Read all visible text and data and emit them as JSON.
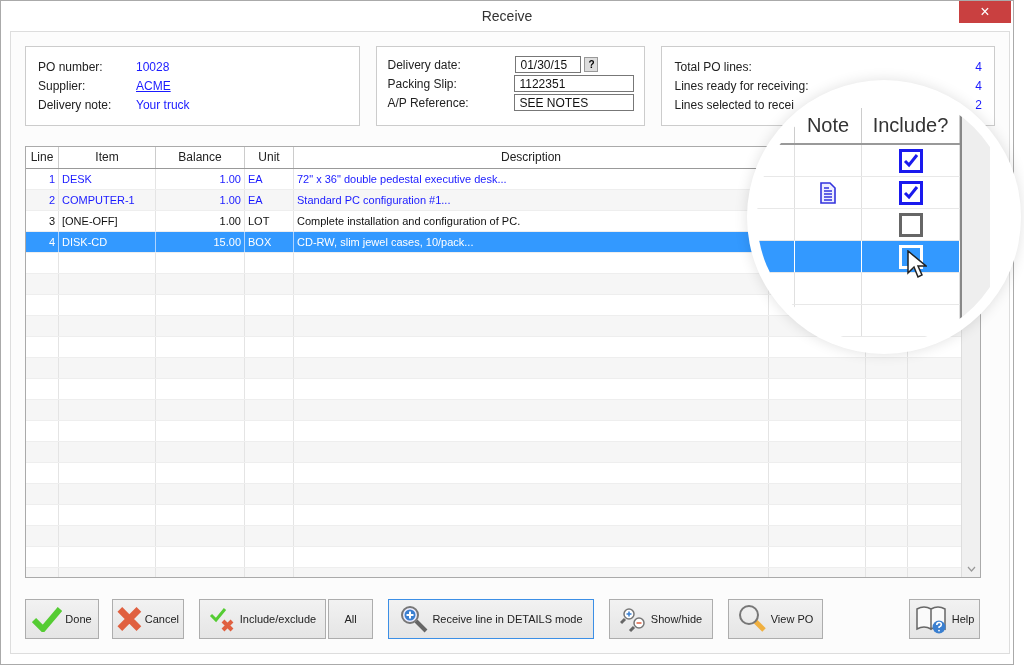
{
  "window": {
    "title": "Receive",
    "close": "×"
  },
  "po_panel": [
    {
      "label": "PO number:",
      "value": "10028",
      "link": false
    },
    {
      "label": "Supplier:",
      "value": "ACME",
      "link": true
    },
    {
      "label": "Delivery note:",
      "value": "Your truck",
      "link": false
    }
  ],
  "delivery_panel": [
    {
      "label": "Delivery date:",
      "value": "01/30/15",
      "kind": "date",
      "button": "?"
    },
    {
      "label": "Packing Slip:",
      "value": "1122351",
      "kind": "text"
    },
    {
      "label": "A/P Reference:",
      "value": "SEE NOTES",
      "kind": "text"
    }
  ],
  "totals_panel": [
    {
      "label": "Total PO lines:",
      "value": "4"
    },
    {
      "label": "Lines ready for receiving:",
      "value": "4"
    },
    {
      "label": "Lines selected to recei",
      "value": "2"
    }
  ],
  "table": {
    "columns": [
      "Line",
      "Item",
      "Balance",
      "Unit",
      "Description"
    ],
    "rows": [
      {
        "line": "1",
        "item": "DESK",
        "balance": "1.00",
        "unit": "EA",
        "description": "72\" x 36\" double pedestal executive desk...",
        "selected": false
      },
      {
        "line": "2",
        "item": "COMPUTER-1",
        "balance": "1.00",
        "unit": "EA",
        "description": "Standard PC configuration #1...",
        "selected": false
      },
      {
        "line": "3",
        "item": "[ONE-OFF]",
        "balance": "1.00",
        "unit": "LOT",
        "description": "Complete installation and configuration of PC.",
        "selected": false
      },
      {
        "line": "4",
        "item": "DISK-CD",
        "balance": "15.00",
        "unit": "BOX",
        "description": "CD-RW, slim jewel cases, 10/pack...",
        "selected": true
      }
    ]
  },
  "magnifier": {
    "columns": [
      "Note",
      "Include?"
    ],
    "rows": [
      {
        "note": false,
        "checked": true,
        "selected": false
      },
      {
        "note": true,
        "checked": true,
        "selected": false
      },
      {
        "note": false,
        "checked": false,
        "selected": false
      },
      {
        "note": false,
        "checked": false,
        "selected": true
      }
    ]
  },
  "buttons": [
    {
      "label": "Done",
      "focused": false
    },
    {
      "label": "Cancel",
      "focused": false
    },
    {
      "label": "Include/exclude",
      "focused": false
    },
    {
      "label": "All",
      "focused": false
    },
    {
      "label": "Receive line in DETAILS mode",
      "focused": true
    },
    {
      "label": "Show/hide",
      "focused": false
    },
    {
      "label": "View PO",
      "focused": false
    },
    {
      "label": "Help",
      "focused": false
    }
  ]
}
